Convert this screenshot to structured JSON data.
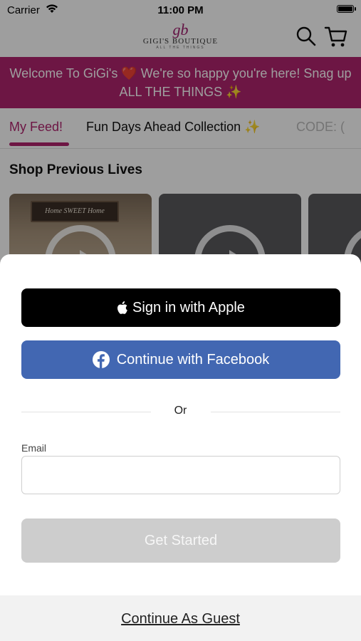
{
  "status_bar": {
    "carrier": "Carrier",
    "time": "11:00 PM"
  },
  "header": {
    "logo_mark": "gb",
    "logo_name": "GIGI'S BOUTIQUE",
    "logo_tagline": "ALL THE THINGS",
    "icons": [
      "search-icon",
      "cart-icon"
    ]
  },
  "announcement": {
    "text": "Welcome To GiGi's ❤️ We're so happy you're here! Snag up ALL THE THINGS ✨"
  },
  "tabs": [
    {
      "label": "My Feed!",
      "active": true
    },
    {
      "label": "Fun Days Ahead Collection ✨",
      "active": false
    },
    {
      "label": "CODE: (",
      "active": false
    }
  ],
  "previous_lives": {
    "title": "Shop Previous Lives",
    "card_sign_text": "Home SWEET Home"
  },
  "login_sheet": {
    "apple_button": "Sign in with Apple",
    "facebook_button": "Continue with Facebook",
    "or_text": "Or",
    "email_label": "Email",
    "email_value": "",
    "get_started": "Get Started",
    "guest_link": "Continue As Guest"
  },
  "colors": {
    "brand": "#b0256f",
    "facebook": "#4267b2",
    "apple": "#000000",
    "disabled": "#cdcdcd"
  }
}
